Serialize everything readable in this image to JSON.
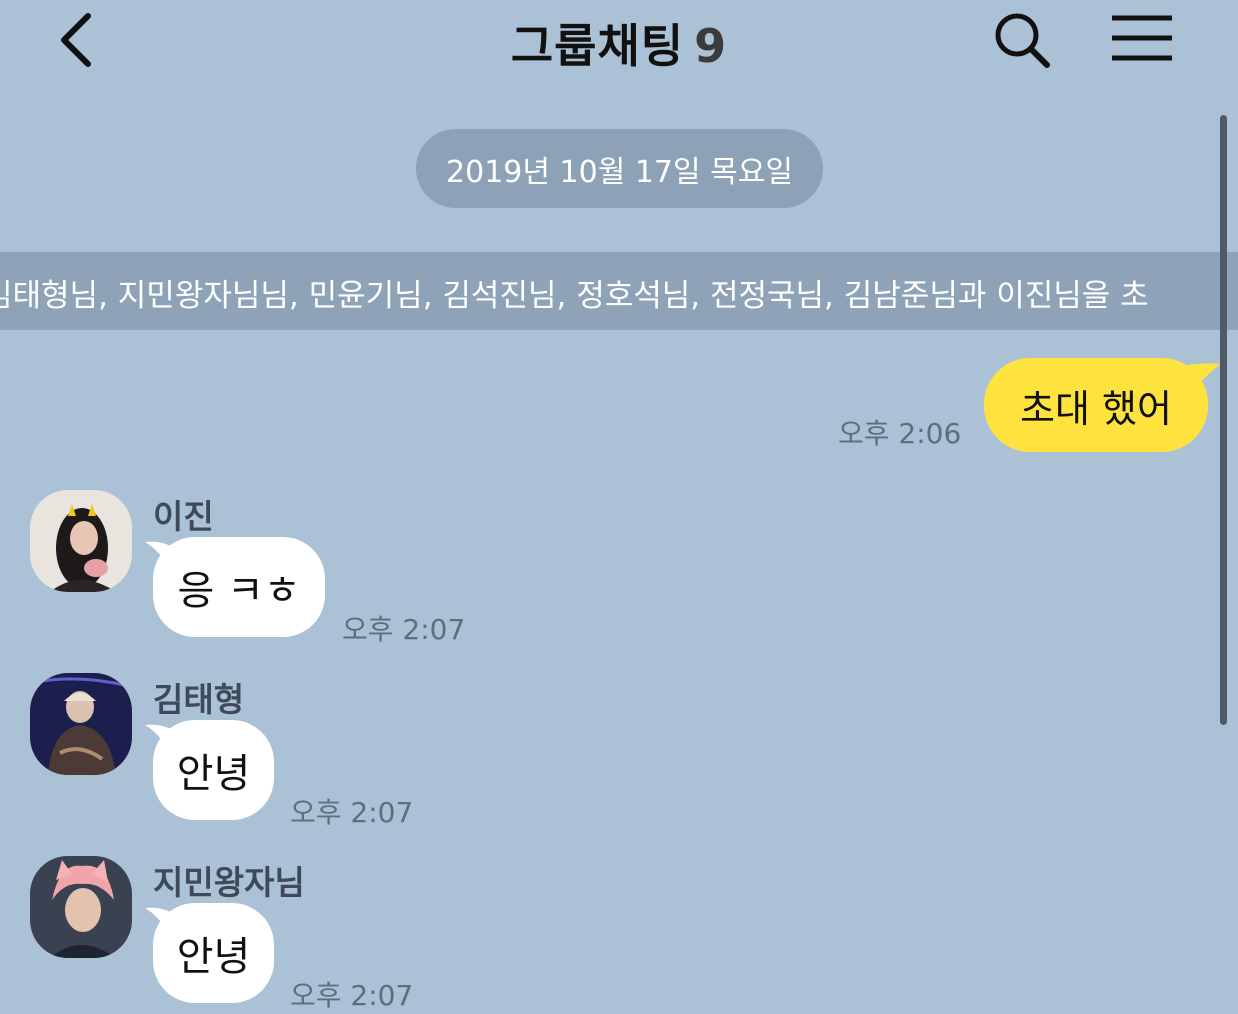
{
  "colors": {
    "background": "#abc1d6",
    "date_pill": "#8da2b6",
    "notice_bar": "#8ea3b7",
    "my_bubble": "#fee33f",
    "their_bubble": "#ffffff"
  },
  "header": {
    "back_icon": "chevron-left-icon",
    "title": "그룹채팅",
    "member_count": "9",
    "search_icon": "search-icon",
    "menu_icon": "hamburger-menu-icon"
  },
  "date_divider": "2019년 10월 17일 목요일",
  "invite_notice": "김태형님, 지민왕자님님, 민윤기님, 김석진님, 정호석님, 전정국님, 김남준님과 이진님을 초",
  "messages": [
    {
      "sender": "me",
      "text": "초대 했어",
      "time": "오후 2:06"
    },
    {
      "sender": "이진",
      "text": "응 ㅋㅎ",
      "time": "오후 2:07"
    },
    {
      "sender": "김태형",
      "text": "안녕",
      "time": "오후 2:07"
    },
    {
      "sender": "지민왕자님",
      "text": "안녕",
      "time": "오후 2:07"
    }
  ]
}
